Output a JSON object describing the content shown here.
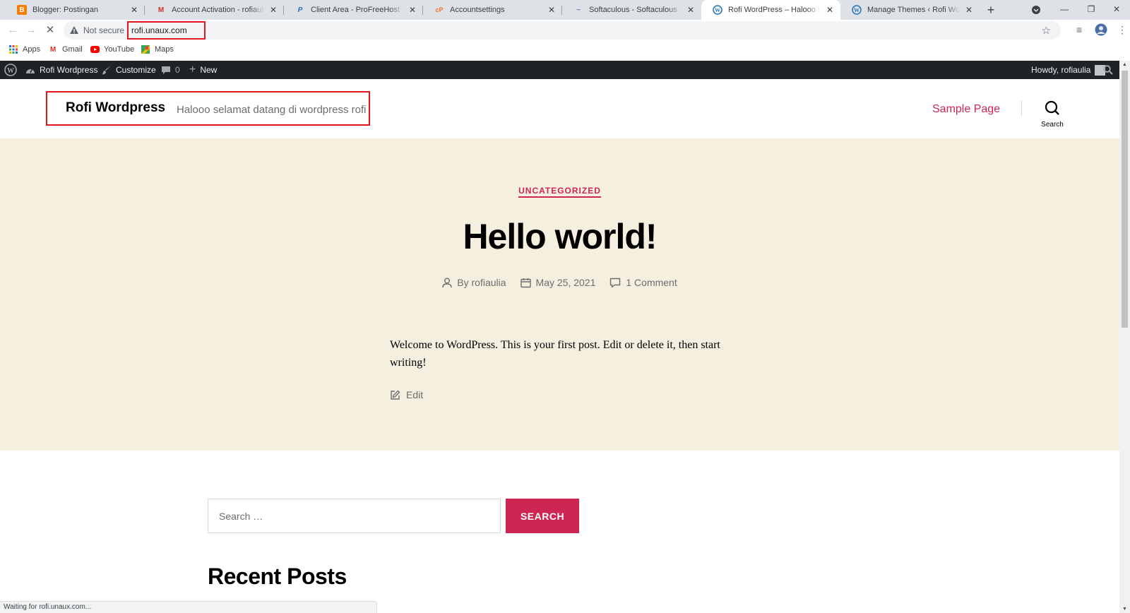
{
  "browser": {
    "tabs": [
      {
        "title": "Blogger: Postingan",
        "favicon": "blogger-icon",
        "color": "#f57d00",
        "glyph": "B"
      },
      {
        "title": "Account Activation - rofiauliagh…",
        "favicon": "gmail-icon",
        "color": "#d93025",
        "glyph": "M"
      },
      {
        "title": "Client Area - ProFreeHost",
        "favicon": "profreehost-icon",
        "color": "#2f6fb8",
        "glyph": "P"
      },
      {
        "title": "Accountsettings",
        "favicon": "cpanel-icon",
        "color": "#ff6c2c",
        "glyph": "cP"
      },
      {
        "title": "Softaculous - Softaculous - Wor…",
        "favicon": "softaculous-icon",
        "color": "#5a7fb0",
        "glyph": "S"
      },
      {
        "title": "Rofi WordPress – Halooo selama…",
        "favicon": "wordpress-icon",
        "color": "#2271b1",
        "glyph": "W"
      },
      {
        "title": "Manage Themes ‹ Rofi Wordpres…",
        "favicon": "wordpress-icon",
        "color": "#2271b1",
        "glyph": "W"
      }
    ],
    "security_label": "Not secure",
    "url": "rofi.unaux.com",
    "bookmarks": [
      {
        "label": "Apps",
        "icon": "apps-grid-icon"
      },
      {
        "label": "Gmail",
        "icon": "gmail-icon"
      },
      {
        "label": "YouTube",
        "icon": "youtube-icon"
      },
      {
        "label": "Maps",
        "icon": "maps-icon"
      }
    ],
    "status_text": "Waiting for rofi.unaux.com..."
  },
  "adminbar": {
    "site_name": "Rofi Wordpress",
    "customize": "Customize",
    "comments_count": "0",
    "new_label": "New",
    "howdy": "Howdy, rofiaulia"
  },
  "site": {
    "title": "Rofi Wordpress",
    "description": "Halooo selamat datang di wordpress rofi",
    "nav": {
      "sample_page": "Sample Page",
      "search_label": "Search"
    }
  },
  "post": {
    "category": "UNCATEGORIZED",
    "title": "Hello world!",
    "author": "By rofiaulia",
    "date": "May 25, 2021",
    "comments": "1 Comment",
    "body": "Welcome to WordPress. This is your first post. Edit or delete it, then start writing!",
    "edit": "Edit"
  },
  "widgets": {
    "search_placeholder": "Search …",
    "search_button": "SEARCH",
    "recent_posts_title": "Recent Posts"
  },
  "colors": {
    "accent": "#cd2653",
    "hero_bg": "#f5efe0",
    "adminbar_bg": "#1d2327",
    "annotation_red": "#e0161f"
  }
}
